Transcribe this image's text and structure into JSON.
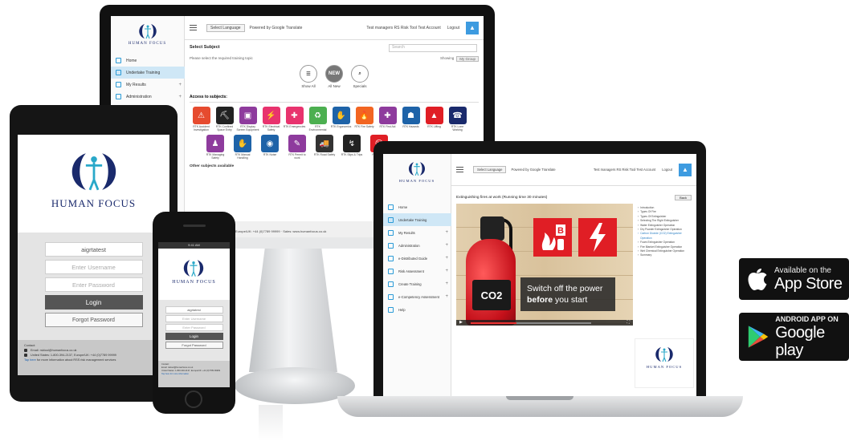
{
  "brand": {
    "name": "HUMAN FOCUS",
    "colors": {
      "navy": "#1a2a6c",
      "blue": "#2a9ad7",
      "red": "#e01e25"
    }
  },
  "desktop": {
    "header": {
      "language_select": "Select Language",
      "translate": "Powered by Google Translate",
      "account": "Test managers RS Risk Tool Test Account",
      "logout": "Logout"
    },
    "nav": [
      {
        "label": "Home",
        "icon": "home-icon"
      },
      {
        "label": "Undertake Training",
        "icon": "training-icon"
      },
      {
        "label": "My Results",
        "icon": "results-icon"
      },
      {
        "label": "Administration",
        "icon": "admin-icon"
      }
    ],
    "select_subject": "Select Subject",
    "search_placeholder": "Search",
    "hint": "Please select the required training topic",
    "display_label": "Showing",
    "display_value": "My Group",
    "filters": [
      {
        "label": "Show All",
        "icon": "list-icon"
      },
      {
        "label": "All New",
        "icon": "new-icon",
        "text": "NEW"
      },
      {
        "label": "Specials",
        "icon": "specials-icon"
      }
    ],
    "access_heading": "Access to subjects:",
    "subjects": [
      {
        "caption": "RTK Accident Investigation",
        "color": "#e64b2f",
        "glyph": "⚠"
      },
      {
        "caption": "RTK Confined Space Entry",
        "color": "#222222",
        "glyph": "⛏"
      },
      {
        "caption": "RTK Display Screen Equipment",
        "color": "#8e3b9d",
        "glyph": "▣"
      },
      {
        "caption": "RTK Electrical Safety",
        "color": "#e8336e",
        "glyph": "⚡"
      },
      {
        "caption": "RTK Emergencies",
        "color": "#e8336e",
        "glyph": "✚"
      },
      {
        "caption": "RTK Environmental",
        "color": "#4caf50",
        "glyph": "♻"
      },
      {
        "caption": "RTK Ergonomics",
        "color": "#1e63a8",
        "glyph": "✋"
      },
      {
        "caption": "RTK Fire Safety",
        "color": "#f26522",
        "glyph": "🔥"
      },
      {
        "caption": "RTK First Aid",
        "color": "#8e3b9d",
        "glyph": "✚"
      },
      {
        "caption": "RTK Hazards",
        "color": "#1e63a8",
        "glyph": "☗"
      },
      {
        "caption": "RTK Lifting",
        "color": "#e01e25",
        "glyph": "▲"
      },
      {
        "caption": "RTK Lone Working",
        "color": "#1a2a6c",
        "glyph": "☎"
      }
    ],
    "subjects_row2": [
      {
        "caption": "RTK Managing Safety",
        "color": "#8e3b9d",
        "glyph": "♟"
      },
      {
        "caption": "RTK Manual Handling",
        "color": "#1e63a8",
        "glyph": "✋"
      },
      {
        "caption": "RTK Noise",
        "color": "#1e63a8",
        "glyph": "◉"
      },
      {
        "caption": "RTK Permit to work",
        "color": "#8e3b9d",
        "glyph": "✎"
      },
      {
        "caption": "RTK Road Safety",
        "color": "#333333",
        "glyph": "🚚"
      },
      {
        "caption": "RTK Slips & Trips",
        "color": "#222222",
        "glyph": "↯"
      },
      {
        "caption": "RTK Stress",
        "color": "#e01e25",
        "glyph": "☹"
      }
    ],
    "other_subjects": "Other subjects available",
    "footer": "United States: 1-800-394-2137, Europe/UK: +44 (0)7789 99999 · Sales: www.humanfocus.co.uk"
  },
  "tablet": {
    "username_display": "aigrtatest",
    "username_placeholder": "Enter Username",
    "password_placeholder": "Enter Password",
    "login": "Login",
    "forgot": "Forgot Password",
    "contact_heading": "Contact:",
    "email": "Email: rsktool@humanfocus.co.uk",
    "phone": "United States: 1-800-394-2137, Europe/UK: +44 (0)7789 99999",
    "more_link": "Tap here",
    "more_text": "for more information about RSS risk management services"
  },
  "phone": {
    "status_time": "9:41 AM",
    "username_display": "aigrtatest",
    "username_placeholder": "Enter Username",
    "password_placeholder": "Enter Password",
    "login": "Login",
    "forgot": "Forgot Password",
    "contact_heading": "Contact:",
    "email": "Email: rsktool@humanfocus.co.uk",
    "phone": "United States: 1-800-394-2137, Europe/UK: +44 (0)7789 99999",
    "more": "Tap here for more information"
  },
  "laptop": {
    "header": {
      "language_select": "Select Language",
      "translate": "Powered by Google Translate",
      "account": "Test managers RS Risk Tool Test Account",
      "logout": "Logout"
    },
    "nav": [
      {
        "label": "Home"
      },
      {
        "label": "Undertake Training"
      },
      {
        "label": "My Results"
      },
      {
        "label": "Administration"
      },
      {
        "label": "e-Distributed Guide"
      },
      {
        "label": "Risk Assessment"
      },
      {
        "label": "Create Training"
      },
      {
        "label": "e-Competency Assessment"
      },
      {
        "label": "Help"
      }
    ],
    "course_title": "Extinguishing fires at work (Running time 30 minutes)",
    "back": "Back",
    "toc": [
      "Introduction",
      "Types Of Fire",
      "Types Of Extinguisher",
      "Selecting The Right Extinguisher",
      "Water Extinguisher Operation",
      "Dry Powder Extinguisher Operation",
      "Carbon Dioxide (CO2) Extinguisher Operation",
      "Foam Extinguisher Operation",
      "Fire Blanket Extinguisher Operation",
      "Wet Chemical Extinguisher Operation",
      "Summary"
    ],
    "toc_current_index": 6,
    "video": {
      "extinguisher_label": "CO2",
      "sign_letter": "B",
      "caption_line1": "Switch off the power",
      "caption_bold": "before",
      "caption_rest": "you start",
      "progress": 0.38
    }
  },
  "stores": {
    "apple": {
      "small": "Available on the",
      "big": "App Store"
    },
    "google": {
      "small": "ANDROID APP ON",
      "big": "Google play"
    }
  }
}
